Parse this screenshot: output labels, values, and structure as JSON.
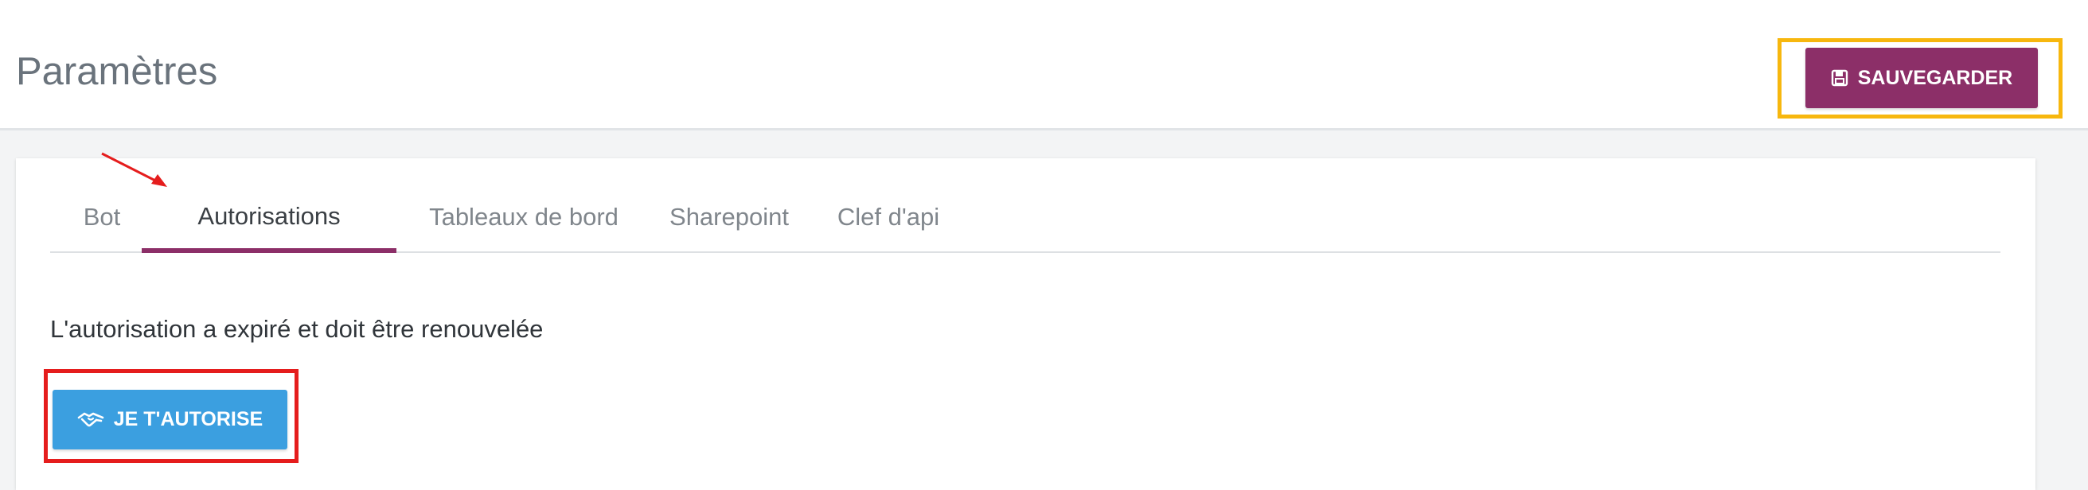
{
  "header": {
    "title": "Paramètres",
    "save_label": "SAUVEGARDER",
    "save_icon": "floppy-disk-icon"
  },
  "tabs": [
    {
      "label": "Bot",
      "active": false
    },
    {
      "label": "Autorisations",
      "active": true
    },
    {
      "label": "Tableaux de bord",
      "active": false
    },
    {
      "label": "Sharepoint",
      "active": false
    },
    {
      "label": "Clef d'api",
      "active": false
    }
  ],
  "authorization": {
    "message": "L'autorisation a expiré et doit être renouvelée",
    "button_label": "JE T'AUTORISE",
    "button_icon": "handshake-icon"
  },
  "colors": {
    "brand": "#8c2f68",
    "button_blue": "#3b9fe0",
    "highlight_yellow": "#f7b70e",
    "highlight_red": "#e51d1d",
    "arrow_red": "#e51d1d"
  }
}
